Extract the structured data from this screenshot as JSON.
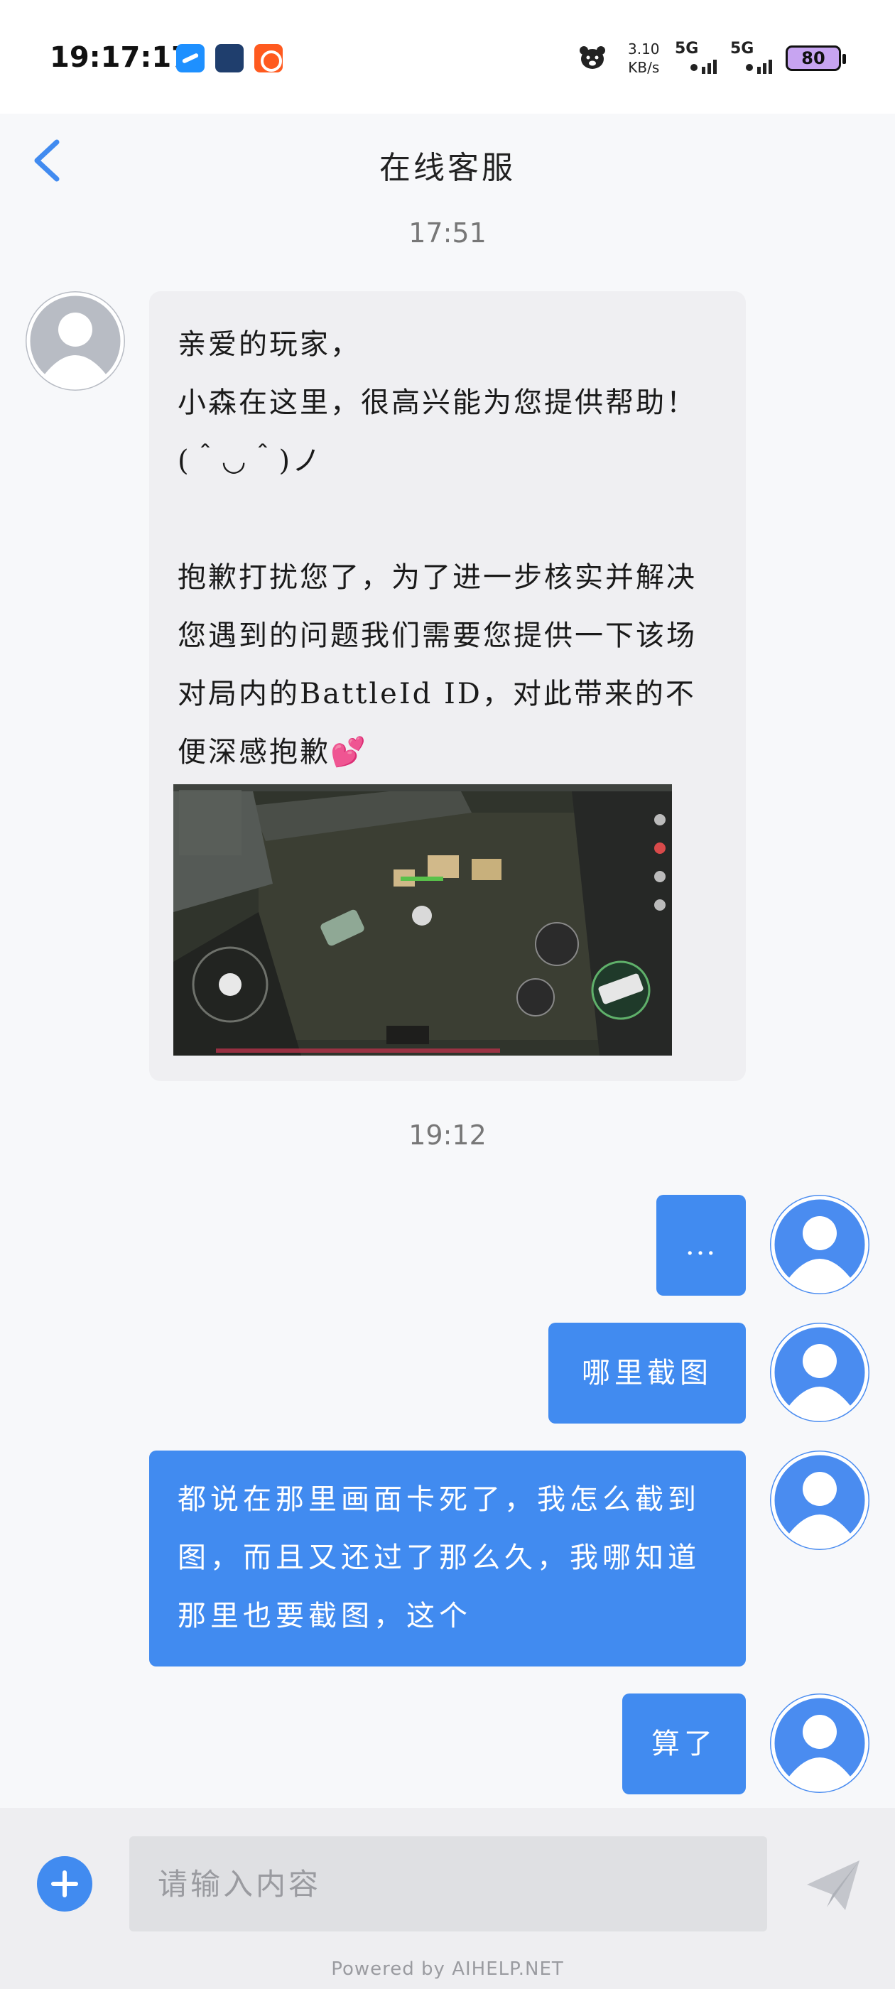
{
  "status_bar": {
    "time": "19:17:17",
    "net_speed_value": "3.10",
    "net_speed_unit": "KB/s",
    "sim1": "5G",
    "sim2": "5G",
    "battery": "80"
  },
  "header": {
    "title": "在线客服"
  },
  "chat": {
    "timestamps": [
      "17:51",
      "19:12"
    ],
    "agent_message": "亲爱的玩家，\n小森在这里，很高兴能为您提供帮助！(＾◡＾)ノ\n\n抱歉打扰您了，为了进一步核实并解决您遇到的问题我们需要您提供一下该场对局内的BattleId ID，对此带来的不便深感抱歉",
    "agent_emoji": "💕",
    "user_messages": [
      "...",
      "哪里截图",
      "都说在那里画面卡死了，我怎么截到图，而且又还过了那么久，我哪知道那里也要截图，这个",
      "算了"
    ]
  },
  "input": {
    "placeholder": "请输入内容"
  },
  "footer": {
    "powered_by": "Powered by AIHELP.NET"
  },
  "colors": {
    "user_bubble": "#418bf0",
    "agent_bubble": "#efeff2",
    "agent_avatar": "#b8bcc4",
    "user_avatar": "#4a8cf0",
    "accent": "#418bf0"
  },
  "icons": {
    "back": "chevron-left-icon",
    "add": "plus-circle-icon",
    "send": "paper-plane-icon"
  }
}
